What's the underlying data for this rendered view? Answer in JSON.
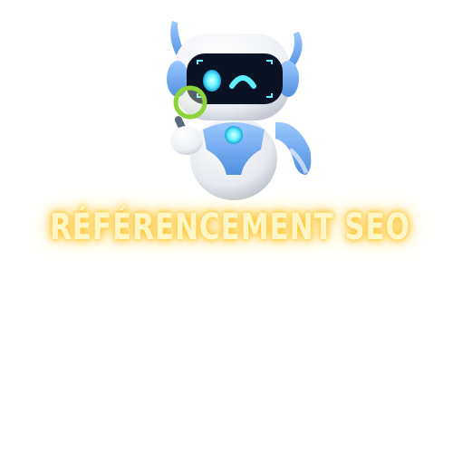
{
  "title": "RÉFÉRENCEMENT SEO",
  "mascot": {
    "icon": "robot-with-magnifying-glass-icon"
  },
  "colors": {
    "glow": "#ffc93a",
    "text": "#fff6c8",
    "robot_white": "#f2f4f8",
    "robot_blue": "#6aa8ee",
    "visor": "#0b1224",
    "eye": "#5ff0ff",
    "lens_ring": "#8cd43a"
  }
}
